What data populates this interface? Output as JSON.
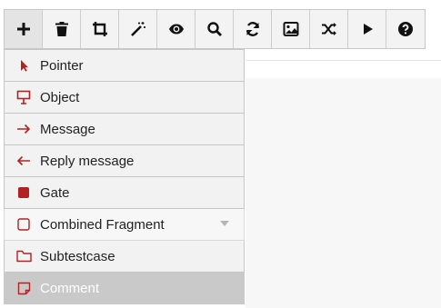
{
  "toolbar": {
    "buttons": [
      {
        "name": "add",
        "icon": "plus-icon"
      },
      {
        "name": "delete",
        "icon": "trash-icon"
      },
      {
        "name": "crop",
        "icon": "crop-icon"
      },
      {
        "name": "magic",
        "icon": "magic-wand-icon"
      },
      {
        "name": "view",
        "icon": "eye-icon"
      },
      {
        "name": "search",
        "icon": "search-icon"
      },
      {
        "name": "refresh",
        "icon": "refresh-icon"
      },
      {
        "name": "image",
        "icon": "image-icon"
      },
      {
        "name": "shuffle",
        "icon": "shuffle-icon"
      },
      {
        "name": "play",
        "icon": "play-icon"
      },
      {
        "name": "help",
        "icon": "help-icon"
      }
    ]
  },
  "menu": {
    "items": [
      {
        "label": "Pointer",
        "icon": "pointer-icon"
      },
      {
        "label": "Object",
        "icon": "object-icon"
      },
      {
        "label": "Message",
        "icon": "arrow-right-icon"
      },
      {
        "label": "Reply message",
        "icon": "arrow-left-icon"
      },
      {
        "label": "Gate",
        "icon": "gate-icon"
      },
      {
        "label": "Combined Fragment",
        "icon": "combined-fragment-icon"
      },
      {
        "label": "Subtestcase",
        "icon": "folder-icon"
      },
      {
        "label": "Comment",
        "icon": "comment-icon"
      }
    ]
  },
  "colors": {
    "accent": "#b22222",
    "selected_bg": "#c9c9c9",
    "toolbar_bg": "#f3f3f3"
  }
}
